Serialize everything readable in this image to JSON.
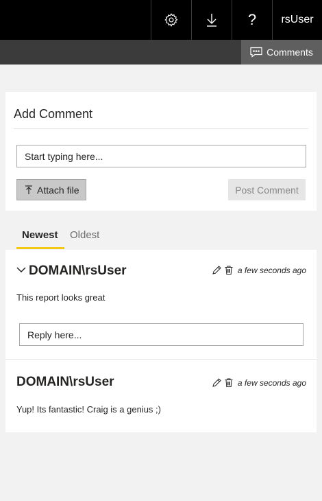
{
  "topbar": {
    "icons": [
      "gear-icon",
      "download-icon",
      "help-icon"
    ],
    "user_label": "rsUser",
    "help_glyph": "?"
  },
  "subbar": {
    "comments_tab_label": "Comments"
  },
  "add_comment": {
    "title": "Add Comment",
    "input_placeholder": "Start typing here...",
    "attach_label": "Attach file",
    "post_label": "Post Comment"
  },
  "tabs": [
    {
      "label": "Newest",
      "active": true
    },
    {
      "label": "Oldest",
      "active": false
    }
  ],
  "comments": [
    {
      "author": "DOMAIN\\rsUser",
      "time": "a few seconds ago",
      "text": "This report looks great",
      "reply_placeholder": "Reply here..."
    },
    {
      "author": "DOMAIN\\rsUser",
      "time": "a few seconds ago",
      "text": "Yup! Its fantastic! Craig is a genius ;)"
    }
  ],
  "colors": {
    "topbar": "#000000",
    "subbar": "#3b3b3b",
    "accent_tab_underline": "#f2c811"
  }
}
